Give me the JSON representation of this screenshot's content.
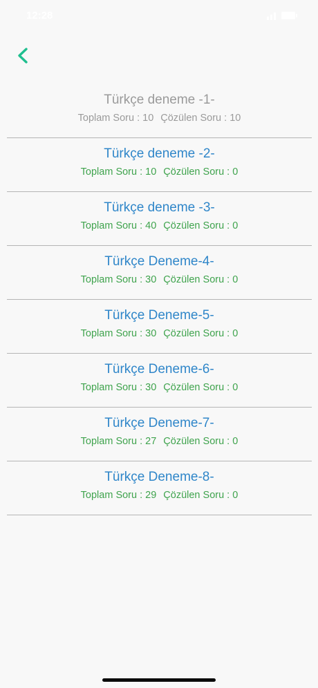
{
  "status_bar": {
    "time": "12:28"
  },
  "nav": {
    "back_icon": "chevron-left-icon",
    "accent_color": "#1fbf8f"
  },
  "colors": {
    "title_active": "#2f86c9",
    "meta_active": "#3fa34d",
    "completed_text": "#9a9a9a",
    "divider": "#b5b5b5"
  },
  "items": [
    {
      "title": "Türkçe deneme -1-",
      "total_label": "Toplam Soru : 10",
      "solved_label": "Çözülen Soru : 10",
      "completed": true
    },
    {
      "title": "Türkçe deneme -2-",
      "total_label": "Toplam Soru : 10",
      "solved_label": "Çözülen Soru : 0",
      "completed": false
    },
    {
      "title": "Türkçe deneme -3-",
      "total_label": "Toplam Soru : 40",
      "solved_label": "Çözülen Soru : 0",
      "completed": false
    },
    {
      "title": "Türkçe Deneme-4-",
      "total_label": "Toplam Soru : 30",
      "solved_label": "Çözülen Soru : 0",
      "completed": false
    },
    {
      "title": "Türkçe Deneme-5-",
      "total_label": "Toplam Soru : 30",
      "solved_label": "Çözülen Soru : 0",
      "completed": false
    },
    {
      "title": "Türkçe Deneme-6-",
      "total_label": "Toplam Soru : 30",
      "solved_label": "Çözülen Soru : 0",
      "completed": false
    },
    {
      "title": "Türkçe Deneme-7-",
      "total_label": "Toplam Soru : 27",
      "solved_label": "Çözülen Soru : 0",
      "completed": false
    },
    {
      "title": "Türkçe Deneme-8-",
      "total_label": "Toplam Soru : 29",
      "solved_label": "Çözülen Soru : 0",
      "completed": false
    }
  ]
}
